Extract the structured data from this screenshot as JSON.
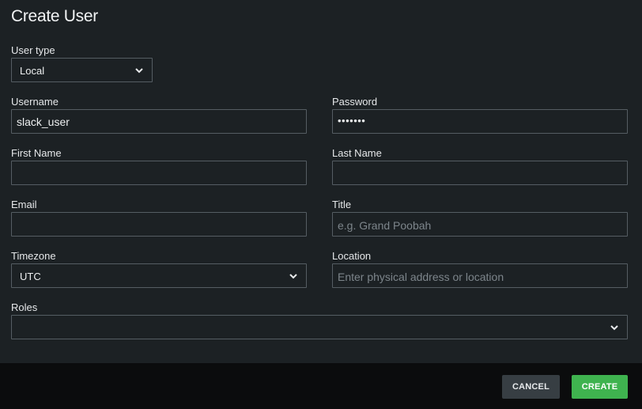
{
  "dialog": {
    "title": "Create User"
  },
  "form": {
    "user_type": {
      "label": "User type",
      "value": "Local"
    },
    "username": {
      "label": "Username",
      "value": "slack_user"
    },
    "password": {
      "label": "Password",
      "value": "•••••••"
    },
    "first_name": {
      "label": "First Name",
      "value": ""
    },
    "last_name": {
      "label": "Last Name",
      "value": ""
    },
    "email": {
      "label": "Email",
      "value": ""
    },
    "title": {
      "label": "Title",
      "placeholder": "e.g. Grand Poobah"
    },
    "timezone": {
      "label": "Timezone",
      "value": "UTC"
    },
    "location": {
      "label": "Location",
      "placeholder": "Enter physical address or location"
    },
    "roles": {
      "label": "Roles",
      "value": ""
    }
  },
  "footer": {
    "cancel_label": "CANCEL",
    "create_label": "CREATE"
  },
  "colors": {
    "background": "#1c2124",
    "footer": "#0b0c0d",
    "border": "#555d63",
    "create_button": "#3fb34f",
    "cancel_button": "#373e43"
  },
  "icons": {
    "select_arrow": "chevron-down-icon"
  }
}
